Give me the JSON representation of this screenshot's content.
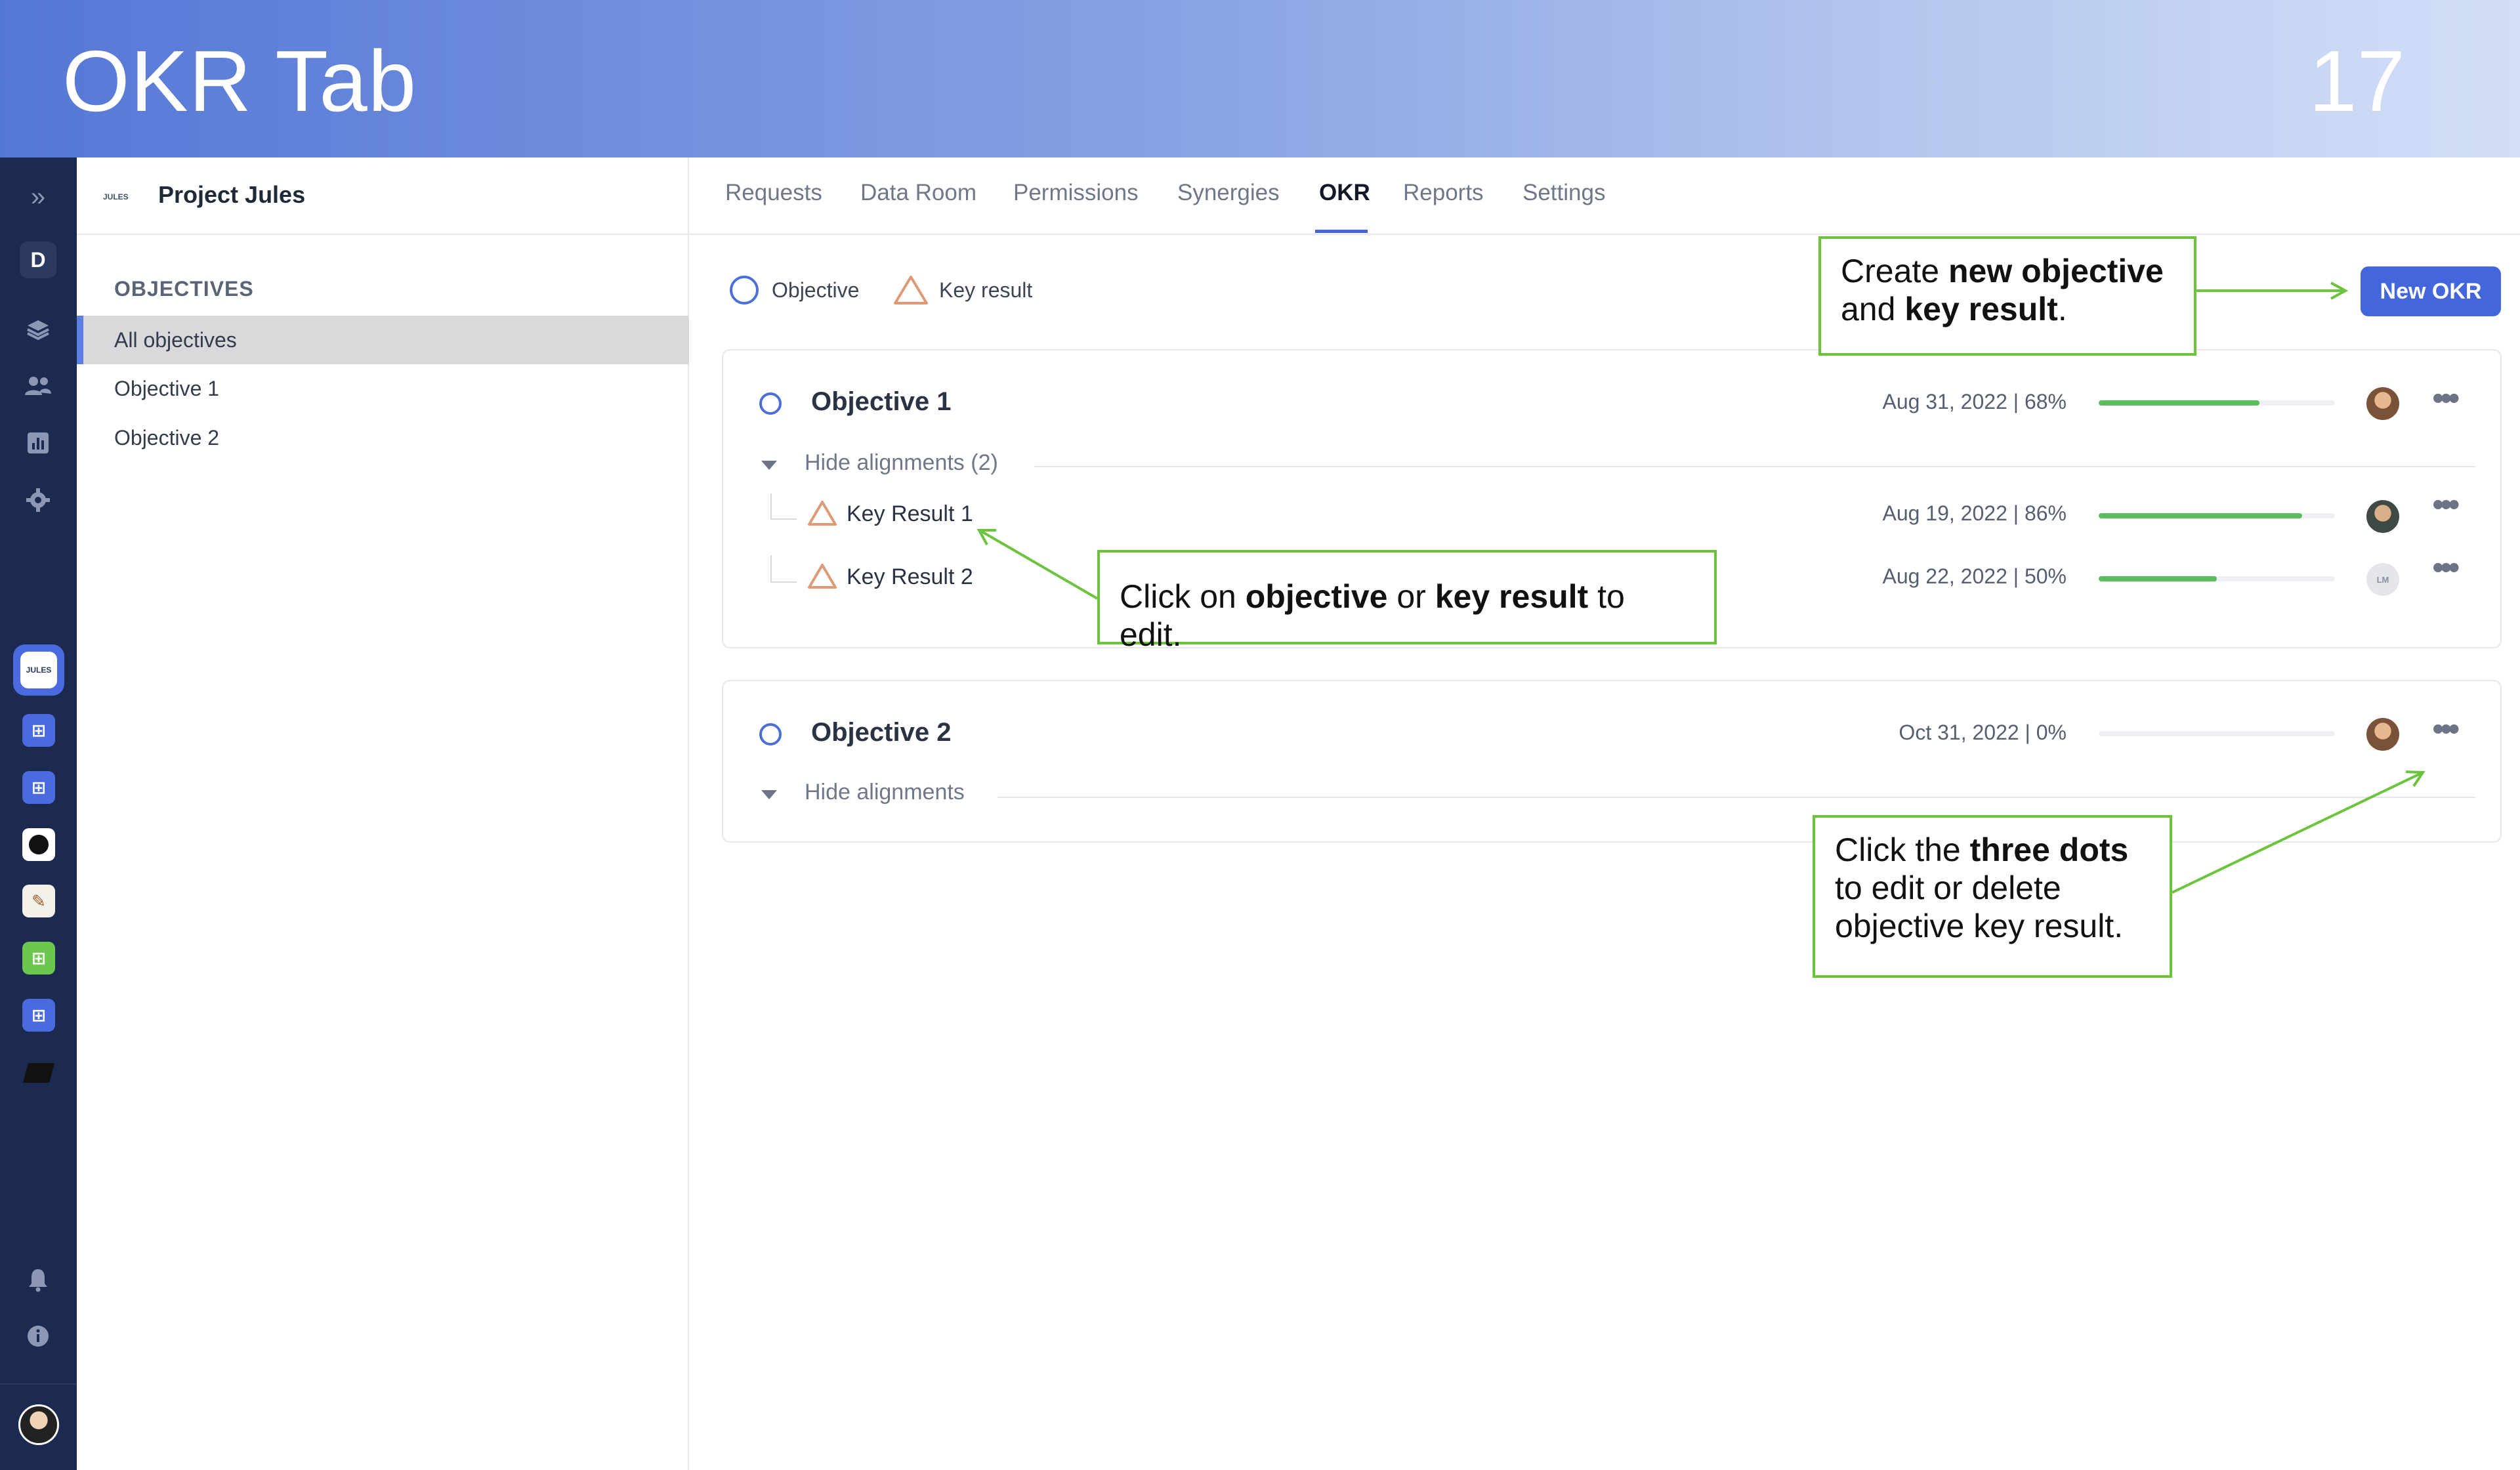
{
  "banner": {
    "title": "OKR Tab",
    "page_number": "17"
  },
  "rail": {
    "user_initial": "D",
    "active_app_label": "JULES"
  },
  "sidebar": {
    "logo_text": "JULES",
    "project_name": "Project Jules",
    "section_title": "OBJECTIVES",
    "items": [
      {
        "label": "All objectives",
        "active": true
      },
      {
        "label": "Objective 1",
        "active": false
      },
      {
        "label": "Objective 2",
        "active": false
      }
    ]
  },
  "tabs": [
    {
      "label": "Requests"
    },
    {
      "label": "Data Room"
    },
    {
      "label": "Permissions"
    },
    {
      "label": "Synergies"
    },
    {
      "label": "OKR",
      "active": true
    },
    {
      "label": "Reports"
    },
    {
      "label": "Settings"
    }
  ],
  "legend": {
    "objective": "Objective",
    "key_result": "Key result"
  },
  "new_okr_button": "New OKR",
  "objectives": [
    {
      "title": "Objective 1",
      "meta": "Aug 31, 2022 | 68%",
      "progress": 0.68,
      "alignments_label": "Hide alignments (2)",
      "key_results": [
        {
          "title": "Key Result 1",
          "meta": "Aug 19, 2022 | 86%",
          "progress": 0.86,
          "avatar": "photo"
        },
        {
          "title": "Key Result 2",
          "meta": "Aug 22, 2022 | 50%",
          "progress": 0.5,
          "avatar": "LM"
        }
      ]
    },
    {
      "title": "Objective 2",
      "meta": "Oct 31, 2022 | 0%",
      "progress": 0.0,
      "alignments_label": "Hide alignments",
      "key_results": []
    }
  ],
  "callouts": {
    "create": {
      "pre": "Create ",
      "b1": "new objective",
      "mid": " and ",
      "b2": "key result",
      "post": "."
    },
    "edit": {
      "pre": "Click on ",
      "b1": "objective",
      "mid": " or ",
      "b2": "key result",
      "post": " to edit."
    },
    "dots": {
      "pre": "Click the ",
      "b1": "three dots",
      "post": " to edit or delete objective key result."
    }
  },
  "colors": {
    "accent": "#4466dd",
    "progress": "#58bd5a",
    "callout_border": "#6cc43c",
    "rail": "#1c2a50"
  }
}
